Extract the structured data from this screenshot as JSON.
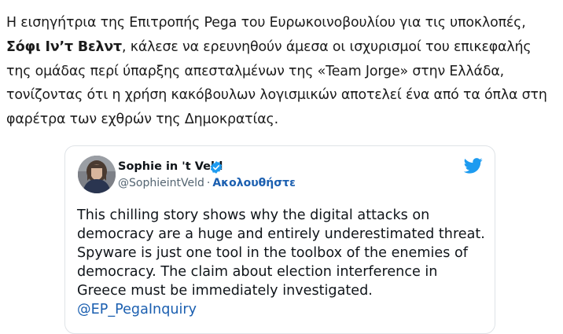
{
  "article": {
    "line1": "Η εισηγήτρια της Επιτροπής Pega του Ευρωκοινοβουλίου για τις υποκλοπές,",
    "line2_bold": "Σόφι Ιν’τ Βελντ",
    "line2_rest": ", κάλεσε να ερευνηθούν άμεσα οι ισχυρισμοί του επικεφαλής",
    "line3": "της ομάδας περί ύπαρξης απεσταλμένων της «Team Jorge» στην Ελλάδα,",
    "line4": "τονίζοντας ότι η χρήση κακόβουλων λογισμικών αποτελεί ένα από τα όπλα στη",
    "line5": "φαρέτρα των εχθρών της Δημοκρατίας."
  },
  "tweet": {
    "author_name": "Sophie in 't Veld",
    "handle": "@SophieintVeld",
    "separator": "·",
    "follow_label": "Ακολουθήστε",
    "text_lines": [
      "This chilling story shows why the digital attacks on",
      "democracy are a huge and entirely underestimated threat.",
      "Spyware is just one tool in the toolbox of the enemies of",
      "democracy. The claim about election interference in",
      "Greece must be immediately investigated."
    ],
    "mention": "@EP_PegaInquiry",
    "icons": {
      "verified": "verified-badge-icon",
      "brand": "twitter-bird-icon"
    },
    "colors": {
      "verified": "#1d9bf0",
      "twitter": "#1d9bf0",
      "link": "#1b5fb0"
    }
  }
}
